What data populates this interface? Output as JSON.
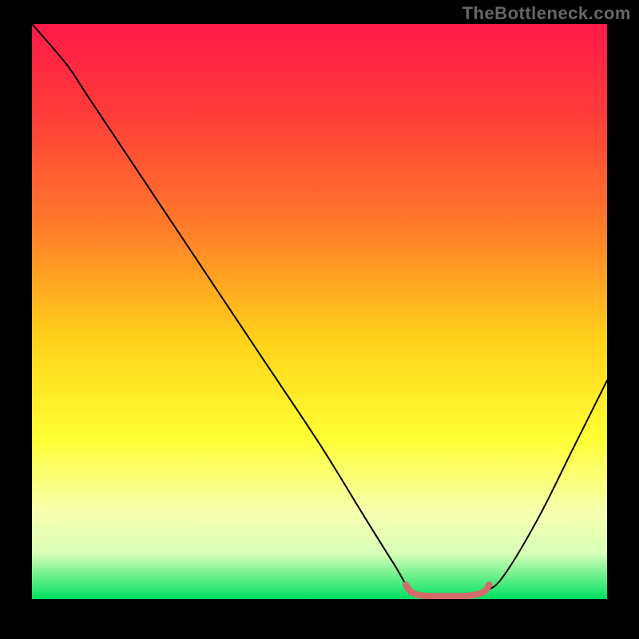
{
  "watermark": "TheBottleneck.com",
  "chart_data": {
    "type": "line",
    "title": "",
    "xlabel": "",
    "ylabel": "",
    "xlim": [
      0,
      100
    ],
    "ylim": [
      0,
      100
    ],
    "background_gradient": {
      "stops": [
        {
          "offset": 0.0,
          "color": "#ff1a4a"
        },
        {
          "offset": 0.15,
          "color": "#ff3a3a"
        },
        {
          "offset": 0.35,
          "color": "#ff7a2a"
        },
        {
          "offset": 0.55,
          "color": "#ffd21a"
        },
        {
          "offset": 0.72,
          "color": "#ffff33"
        },
        {
          "offset": 0.85,
          "color": "#f6ffb0"
        },
        {
          "offset": 0.92,
          "color": "#d8ffb8"
        },
        {
          "offset": 1.0,
          "color": "#00e060"
        }
      ]
    },
    "series": [
      {
        "name": "bottleneck-curve",
        "stroke": "#000000",
        "stroke_width": 2,
        "points": [
          {
            "x": 0,
            "y": 100
          },
          {
            "x": 6,
            "y": 93
          },
          {
            "x": 10,
            "y": 87
          },
          {
            "x": 20,
            "y": 72
          },
          {
            "x": 30,
            "y": 57
          },
          {
            "x": 40,
            "y": 42
          },
          {
            "x": 50,
            "y": 27
          },
          {
            "x": 58,
            "y": 14
          },
          {
            "x": 63,
            "y": 6
          },
          {
            "x": 66,
            "y": 1.5
          },
          {
            "x": 70,
            "y": 0.5
          },
          {
            "x": 75,
            "y": 0.5
          },
          {
            "x": 79,
            "y": 1.5
          },
          {
            "x": 82,
            "y": 4
          },
          {
            "x": 88,
            "y": 14
          },
          {
            "x": 94,
            "y": 26
          },
          {
            "x": 100,
            "y": 38
          }
        ]
      },
      {
        "name": "optimal-zone-marker",
        "stroke": "#d46a6a",
        "stroke_width": 8,
        "points": [
          {
            "x": 65,
            "y": 2.5
          },
          {
            "x": 66,
            "y": 1.2
          },
          {
            "x": 68,
            "y": 0.6
          },
          {
            "x": 72,
            "y": 0.5
          },
          {
            "x": 76,
            "y": 0.6
          },
          {
            "x": 78.5,
            "y": 1.2
          },
          {
            "x": 79.5,
            "y": 2.5
          }
        ]
      }
    ]
  }
}
